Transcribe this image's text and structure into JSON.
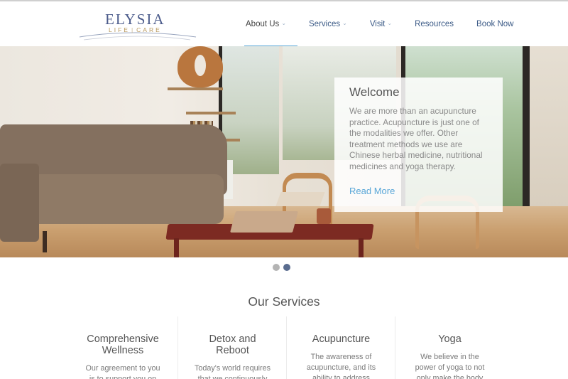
{
  "brand": {
    "name": "ELYSIA",
    "sub_left": "LIFE",
    "sub_right": "CARE"
  },
  "nav": [
    {
      "label": "About Us",
      "dropdown": true,
      "active": true
    },
    {
      "label": "Services",
      "dropdown": true,
      "active": false
    },
    {
      "label": "Visit",
      "dropdown": true,
      "active": false
    },
    {
      "label": "Resources",
      "dropdown": false,
      "active": false
    },
    {
      "label": "Book Now",
      "dropdown": false,
      "active": false
    }
  ],
  "hero": {
    "title": "Welcome",
    "text": "We are more than an acupuncture practice. Acupuncture is just one of the modalities we offer. Other treatment methods we use are Chinese herbal medicine, nutritional medicines and yoga therapy.",
    "link": "Read More",
    "slides_total": 2,
    "slide_active": 2
  },
  "services": {
    "title": "Our Services",
    "items": [
      {
        "title": "Comprehensive Wellness",
        "text": "Our agreement to you is to support you on your"
      },
      {
        "title": "Detox and Reboot",
        "text": "Today's world requires that we continuously"
      },
      {
        "title": "Acupuncture",
        "text": "The awareness of acupuncture, and its ability to address"
      },
      {
        "title": "Yoga",
        "text": "We believe in the power of yoga to not only make the body more fit and"
      }
    ]
  },
  "colors": {
    "accent": "#5aa7d8",
    "nav_text": "#3b5a86",
    "brand_blue": "#4a5a8a",
    "brand_gold": "#b7975a"
  },
  "icons": {
    "dropdown": "chevron-down-icon"
  }
}
